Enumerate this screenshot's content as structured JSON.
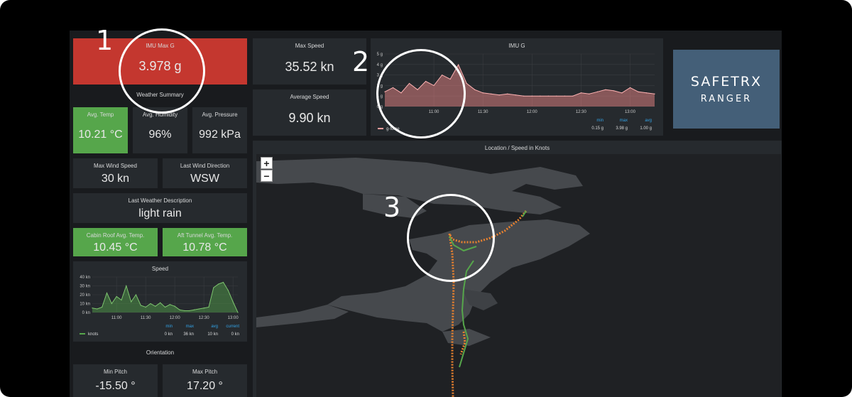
{
  "annotations": {
    "n1": "1",
    "n2": "2",
    "n3": "3"
  },
  "imu_max": {
    "title": "IMU Max G",
    "value": "3.978 g"
  },
  "weather": {
    "title": "Weather Summary"
  },
  "avg_temp": {
    "title": "Avg. Temp",
    "value": "10.21 °C"
  },
  "avg_humidity": {
    "title": "Avg. Humidity",
    "value": "96%"
  },
  "avg_pressure": {
    "title": "Avg. Pressure",
    "value": "992 kPa"
  },
  "max_wind": {
    "title": "Max Wind Speed",
    "value": "30 kn"
  },
  "wind_dir": {
    "title": "Last Wind Direction",
    "value": "WSW"
  },
  "weather_desc": {
    "title": "Last Weather Description",
    "value": "light rain"
  },
  "cabin": {
    "title": "Cabin Roof Avg. Temp.",
    "value": "10.45 °C"
  },
  "aft": {
    "title": "Aft Tunnel Avg. Temp.",
    "value": "10.78 °C"
  },
  "speed_chart": {
    "title": "Speed",
    "legend": "knots",
    "stats_headers": [
      "min",
      "max",
      "avg",
      "current"
    ],
    "stats_values": [
      "0 kn",
      "36 kn",
      "10 kn",
      "0 kn"
    ]
  },
  "orientation": {
    "title": "Orientation"
  },
  "min_pitch": {
    "title": "Min Pitch",
    "value": "-15.50 °"
  },
  "max_pitch": {
    "title": "Max Pitch",
    "value": "17.20 °"
  },
  "max_speed": {
    "title": "Max Speed",
    "value": "35.52 kn"
  },
  "avg_speed": {
    "title": "Average Speed",
    "value": "9.90 kn"
  },
  "imu_chart": {
    "title": "IMU G",
    "legend": "g-force",
    "stats_headers": [
      "min",
      "max",
      "avg"
    ],
    "stats_values": [
      "0.15 g",
      "3.98 g",
      "1.00 g"
    ]
  },
  "logo": {
    "line1": "SAFETRX",
    "line2": "RANGER"
  },
  "map": {
    "title": "Location / Speed in Knots",
    "zoom_in": "+",
    "zoom_out": "−"
  },
  "colors": {
    "green": "#56a64b",
    "red": "#c4372f",
    "panel": "#262a2e",
    "accent_blue": "#33a2e5",
    "orange": "#e8812f",
    "imu_line": "#ff9e9e",
    "logo_bg": "#445f78"
  },
  "chart_data": [
    {
      "type": "area",
      "title": "Speed",
      "x": [
        "10:35",
        "10:40",
        "10:45",
        "10:50",
        "10:55",
        "11:00",
        "11:05",
        "11:10",
        "11:15",
        "11:20",
        "11:25",
        "11:30",
        "11:35",
        "11:40",
        "11:45",
        "11:50",
        "11:55",
        "12:00",
        "12:05",
        "12:10",
        "12:15",
        "12:20",
        "12:25",
        "12:30",
        "12:35",
        "12:40",
        "12:45",
        "12:50",
        "12:55",
        "13:00",
        "13:05"
      ],
      "series": [
        {
          "name": "knots",
          "values": [
            5,
            4,
            6,
            22,
            10,
            18,
            14,
            30,
            12,
            20,
            8,
            6,
            10,
            7,
            11,
            6,
            9,
            7,
            3,
            2,
            2,
            3,
            4,
            5,
            6,
            28,
            32,
            34,
            25,
            12,
            0
          ]
        }
      ],
      "y_ticks": [
        "40 kn",
        "30 kn",
        "20 kn",
        "10 kn",
        "0 kn"
      ],
      "x_ticks": [
        "11:00",
        "11:30",
        "12:00",
        "12:30",
        "13:00"
      ],
      "ylim": [
        0,
        40
      ]
    },
    {
      "type": "area",
      "title": "IMU G",
      "x": [
        "10:30",
        "10:35",
        "10:40",
        "10:45",
        "10:50",
        "10:55",
        "11:00",
        "11:05",
        "11:10",
        "11:15",
        "11:20",
        "11:25",
        "11:30",
        "11:35",
        "11:40",
        "11:45",
        "11:50",
        "11:55",
        "12:00",
        "12:05",
        "12:10",
        "12:15",
        "12:20",
        "12:25",
        "12:30",
        "12:35",
        "12:40",
        "12:45",
        "12:50",
        "12:55",
        "13:00",
        "13:05",
        "13:10",
        "13:15"
      ],
      "series": [
        {
          "name": "g-force",
          "values": [
            1.4,
            1.8,
            1.3,
            2.2,
            1.6,
            2.4,
            2.0,
            3.0,
            2.6,
            3.98,
            2.2,
            1.6,
            1.3,
            1.2,
            1.1,
            1.2,
            1.1,
            1.0,
            1.0,
            1.0,
            1.0,
            1.0,
            1.0,
            1.0,
            1.3,
            1.2,
            1.4,
            1.6,
            1.5,
            1.3,
            1.8,
            1.4,
            1.3,
            1.2
          ]
        }
      ],
      "y_ticks": [
        "5 g",
        "4 g",
        "3 g",
        "2 g",
        "1 g",
        "0 g"
      ],
      "x_ticks": [
        "11:00",
        "11:30",
        "12:00",
        "12:30",
        "13:00"
      ],
      "ylim": [
        0,
        5
      ]
    }
  ]
}
